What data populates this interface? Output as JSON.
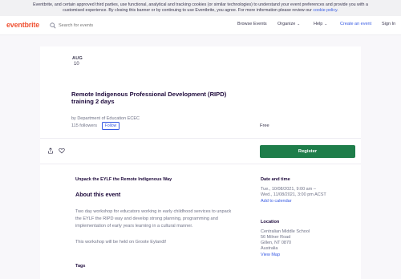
{
  "cookie_banner": {
    "text_line1": "Eventbrite, and certain approved third parties, use functional, analytical and tracking cookies (or similar technologies) to understand your event preferences and provide you with a",
    "text_line2": "customised experience. By closing this banner or by continuing to use Eventbrite, you agree. For more information please review our ",
    "link": "cookie policy",
    "end": "."
  },
  "header": {
    "logo": "eventbrite",
    "search_placeholder": "Search for events",
    "nav": {
      "browse": "Browse Events",
      "organize": "Organize",
      "help": "Help",
      "create": "Create an event",
      "signin": "Sign In"
    }
  },
  "event": {
    "month": "AUG",
    "day": "10",
    "title": "Remote Indigenous Professional Development (RIPD) training 2 days",
    "organizer": "by Department of Education ECEC",
    "followers": "115 followers",
    "follow_label": "Follow",
    "price": "Free",
    "register_label": "Register",
    "subtitle": "Unpack the EYLF the Remote Indigenous Way",
    "about_heading": "About this event",
    "description": "Two day workshop for educators working in early childhood services to unpack the EYLF the RIPD way and develop strong planning, programming and implementation of early years learning in a cultural manner.",
    "description2": "This workshop will be held on Groote Eylandt!",
    "tags_heading": "Tags"
  },
  "sidebar": {
    "datetime_heading": "Date and time",
    "datetime_line1": "Tue., 10/08/2021, 9:00 am –",
    "datetime_line2": "Wed., 11/08/2021, 3:00 pm ACST",
    "add_calendar": "Add to calendar",
    "location_heading": "Location",
    "location_line1": "Centralian Middle School",
    "location_line2": "56 Milner Road",
    "location_line3": "Gillen, NT 0870",
    "location_line4": "Australia",
    "view_map": "View Map"
  },
  "colors": {
    "brand": "#f05537",
    "accent": "#3659e3",
    "register": "#1e7d4a"
  }
}
